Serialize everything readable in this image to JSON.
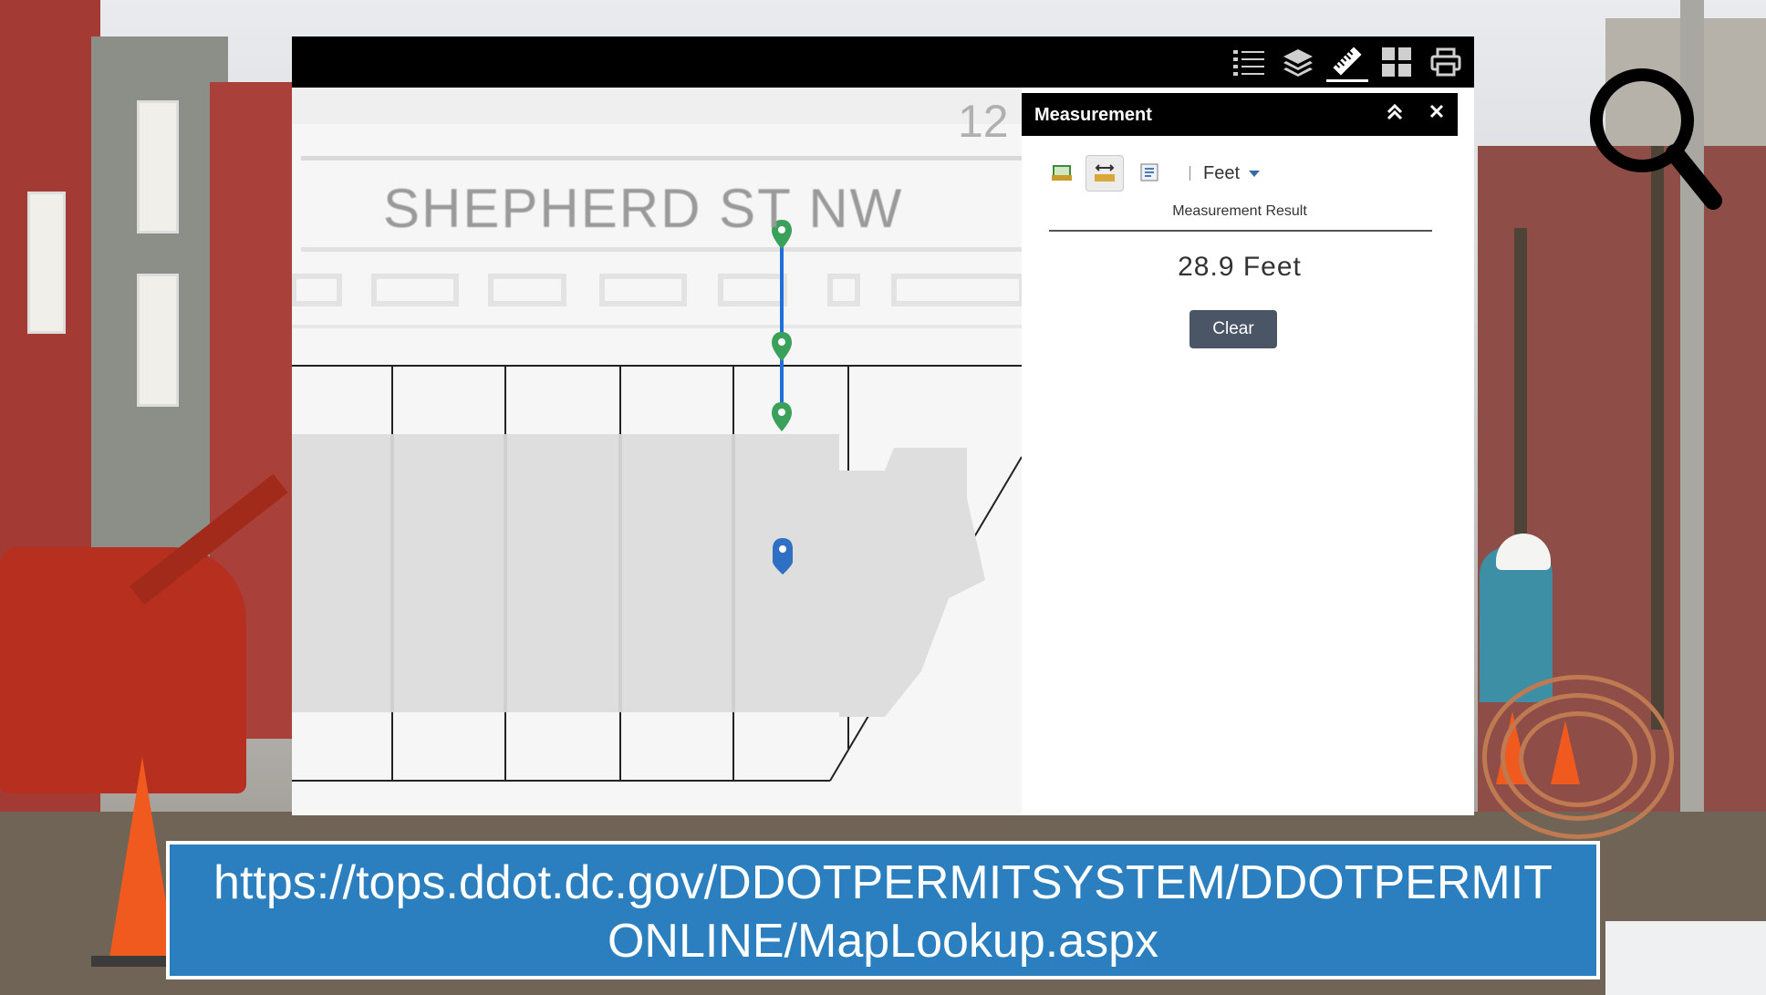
{
  "toolbar": {
    "tools": [
      "legend-icon",
      "layers-icon",
      "measure-ruler-icon",
      "basemap-grid-icon",
      "print-icon"
    ],
    "active_tool": "measure-ruler-icon"
  },
  "map": {
    "street_label": "SHEPHERD ST NW",
    "address_partial": "12"
  },
  "measurement": {
    "title": "Measurement",
    "unit": "Feet",
    "result_label": "Measurement Result",
    "result_value": "28.9 Feet",
    "clear_label": "Clear",
    "collapse_icon": "double-chevron-up-icon",
    "close_icon": "close-icon"
  },
  "banner": {
    "line1": "https://tops.ddot.dc.gov/DDOTPERMITSYSTEM/DDOTPERMIT",
    "line2": "ONLINE/MapLookup.aspx"
  },
  "colors": {
    "measure_line": "#1e6fd9",
    "vertex_marker": "#3aa15a",
    "location_marker": "#2f6fc4",
    "banner": "#2b7fbe",
    "panel_header": "#000000"
  }
}
